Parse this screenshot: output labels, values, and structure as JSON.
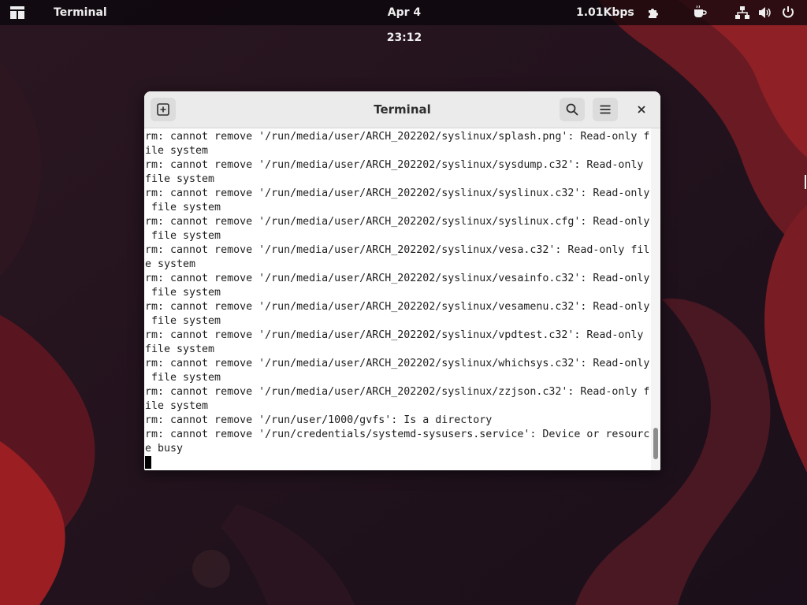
{
  "topbar": {
    "app_menu": "Terminal",
    "clock": "Apr 4  23:12",
    "netspeed": "1.01Kbps",
    "icons": [
      "activities-icon",
      "extension-icon",
      "caffeine-icon",
      "network-icon",
      "volume-icon",
      "power-icon"
    ]
  },
  "window": {
    "title": "Terminal",
    "icons": [
      "new-tab-icon",
      "search-icon",
      "hamburger-menu-icon",
      "close-icon"
    ]
  },
  "terminal": {
    "lines": [
      "rm: cannot remove '/run/media/user/ARCH_202202/syslinux/splash.png': Read-only f",
      "ile system",
      "rm: cannot remove '/run/media/user/ARCH_202202/syslinux/sysdump.c32': Read-only",
      "file system",
      "rm: cannot remove '/run/media/user/ARCH_202202/syslinux/syslinux.c32': Read-only",
      " file system",
      "rm: cannot remove '/run/media/user/ARCH_202202/syslinux/syslinux.cfg': Read-only",
      " file system",
      "rm: cannot remove '/run/media/user/ARCH_202202/syslinux/vesa.c32': Read-only fil",
      "e system",
      "rm: cannot remove '/run/media/user/ARCH_202202/syslinux/vesainfo.c32': Read-only",
      " file system",
      "rm: cannot remove '/run/media/user/ARCH_202202/syslinux/vesamenu.c32': Read-only",
      " file system",
      "rm: cannot remove '/run/media/user/ARCH_202202/syslinux/vpdtest.c32': Read-only",
      "file system",
      "rm: cannot remove '/run/media/user/ARCH_202202/syslinux/whichsys.c32': Read-only",
      " file system",
      "rm: cannot remove '/run/media/user/ARCH_202202/syslinux/zzjson.c32': Read-only f",
      "ile system",
      "rm: cannot remove '/run/user/1000/gvfs': Is a directory",
      "rm: cannot remove '/run/credentials/systemd-sysusers.service': Device or resourc",
      "e busy"
    ],
    "scroll_position": 0.98
  },
  "colors": {
    "topbar_bg": "#0d0a0f",
    "headerbar_bg": "#ebebeb",
    "terminal_bg": "#ffffff",
    "terminal_fg": "#1e1e1e",
    "wallpaper_dark": "#1c1220",
    "wallpaper_red": "#8c1c24"
  }
}
